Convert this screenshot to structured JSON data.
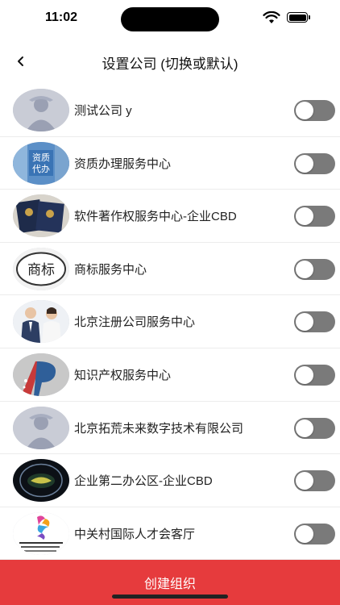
{
  "status": {
    "time": "11:02"
  },
  "nav": {
    "title": "设置公司 (切换或默认)"
  },
  "companies": [
    {
      "name": "测试公司 y",
      "avatar": "default-person-icon",
      "enabled": false
    },
    {
      "name": "资质办理服务中心",
      "avatar": "qualification-logo",
      "avatar_text": "资质 代办",
      "enabled": false
    },
    {
      "name": "软件著作权服务中心-企业CBD",
      "avatar": "certificate-books-logo",
      "enabled": false
    },
    {
      "name": "商标服务中心",
      "avatar": "trademark-logo",
      "avatar_text": "商标",
      "enabled": false
    },
    {
      "name": "北京注册公司服务中心",
      "avatar": "business-people-logo",
      "enabled": false
    },
    {
      "name": "知识产权服务中心",
      "avatar": "ip-logo",
      "enabled": false
    },
    {
      "name": "北京拓荒未来数字技术有限公司",
      "avatar": "default-person-icon",
      "enabled": false
    },
    {
      "name": "企业第二办公区-企业CBD",
      "avatar": "dark-badge-logo",
      "enabled": false
    },
    {
      "name": "中关村国际人才会客厅",
      "avatar": "zpark-logo",
      "avatar_text": "Z-Park International Talent Reception Hall",
      "enabled": false
    }
  ],
  "footer": {
    "create_label": "创建组织"
  },
  "colors": {
    "accent": "#e63b3d",
    "toggle_off": "#7a7a7a"
  }
}
